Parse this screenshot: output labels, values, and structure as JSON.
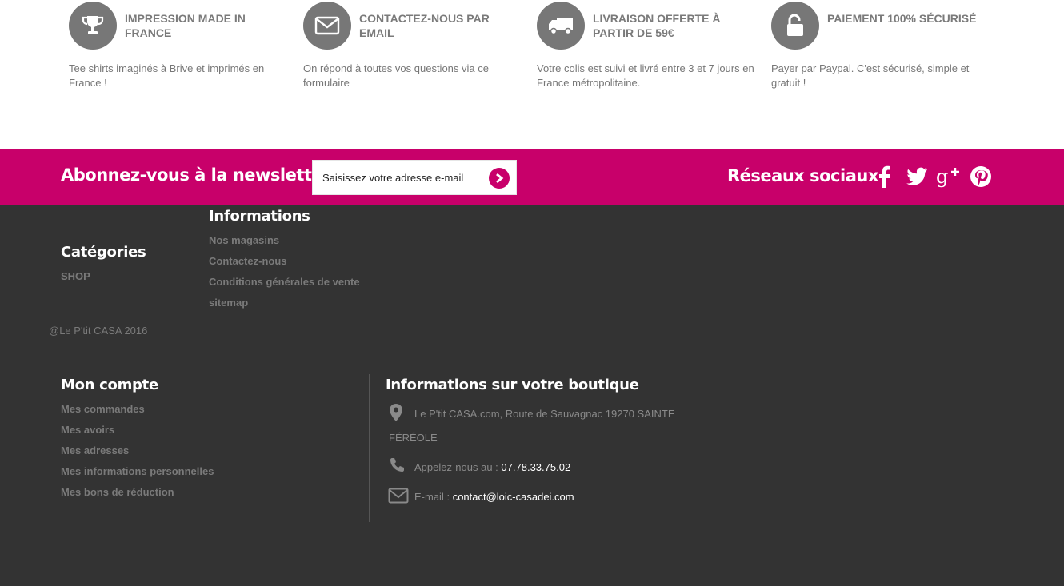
{
  "features": [
    {
      "icon": "trophy-icon",
      "title": "IMPRESSION MADE IN FRANCE",
      "desc": "Tee shirts imaginés à Brive et imprimés en France !"
    },
    {
      "icon": "envelope-icon",
      "title": "CONTACTEZ-NOUS PAR EMAIL",
      "desc": "On répond à toutes vos questions via ce formulaire"
    },
    {
      "icon": "truck-icon",
      "title": "LIVRAISON OFFERTE À PARTIR DE 59€",
      "desc": "Votre colis est suivi et livré entre 3 et 7 jours en France métropolitaine."
    },
    {
      "icon": "unlock-icon",
      "title": "PAIEMENT 100% SÉCURISÉ",
      "desc": "Payer par Paypal. C'est sécurisé, simple et gratuit !"
    }
  ],
  "newsletter": {
    "title": "Abonnez-vous à la newsletter",
    "placeholder": "Saisissez votre adresse e-mail",
    "submit_icon": "chevron-right-circle-icon"
  },
  "social": {
    "title": "Réseaux sociaux",
    "icons": [
      "facebook-icon",
      "twitter-icon",
      "google-plus-icon",
      "pinterest-icon"
    ]
  },
  "colors": {
    "brand": "#c8006a",
    "footer_bg": "#333333",
    "icon_circle": "#777777"
  },
  "footer": {
    "categories": {
      "title": "Catégories",
      "items": [
        "SHOP"
      ]
    },
    "informations": {
      "title": "Informations",
      "items": [
        "Nos magasins",
        "Contactez-nous",
        "Conditions générales de vente",
        "sitemap"
      ]
    },
    "copyright": "@Le P'tit CASA 2016",
    "account": {
      "title": "Mon compte",
      "items": [
        "Mes commandes",
        "Mes avoirs",
        "Mes adresses",
        "Mes informations personnelles",
        "Mes bons de réduction"
      ]
    },
    "store": {
      "title": "Informations sur votre boutique",
      "address_line1": "Le P'tit CASA.com, Route de Sauvagnac 19270 SAINTE",
      "address_line2": "FÉRÉOLE",
      "phone_label": "Appelez-nous au :",
      "phone": "07.78.33.75.02",
      "email_label": "E-mail :",
      "email": "contact@loic-casadei.com"
    }
  }
}
